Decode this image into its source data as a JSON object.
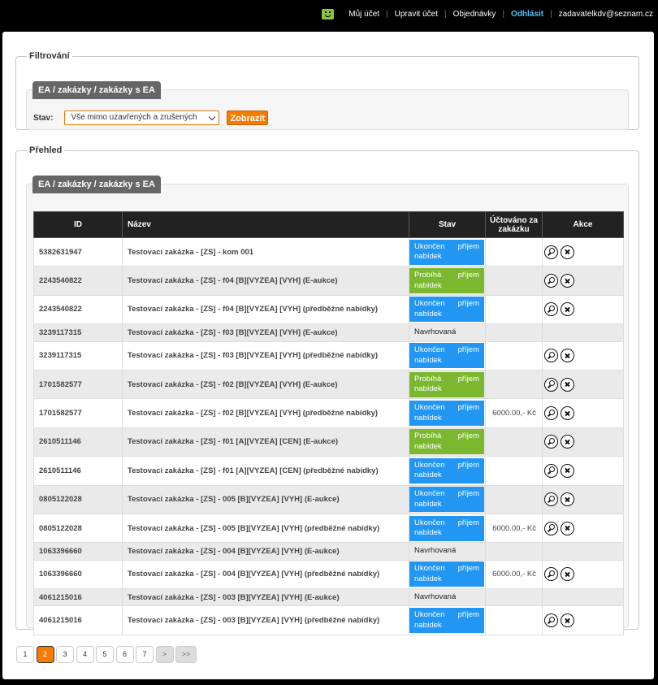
{
  "topbar": {
    "my_account": "Můj účet",
    "edit_account": "Upravit účet",
    "orders": "Objednávky",
    "logout": "Odhlásit",
    "email": "zadavatelkdv@seznam.cz"
  },
  "filter": {
    "legend": "Filtrování",
    "tab": "EA / zakázky / zakázky s EA",
    "status_label": "Stav:",
    "status_value": "Vše mimo uzavřených a zrušených",
    "submit_label": "Zobrazit"
  },
  "overview": {
    "legend": "Přehled",
    "tab": "EA / zakázky / zakázky s EA",
    "columns": {
      "id": "ID",
      "name": "Název",
      "status": "Stav",
      "billed": "Účtováno za zakázku",
      "actions": "Akce"
    },
    "rows": [
      {
        "id": "5382631947",
        "name": "Testovací zakázka - [ZS] - kom 001",
        "status": "Ukončen příjem nabídek",
        "status_type": "blue",
        "billed": "",
        "actions": true
      },
      {
        "id": "2243540822",
        "name": "Testovací zakázka - [ZS] - f04 [B][VYZEA] [VYH] (E-aukce)",
        "status": "Probíhá příjem nabídek",
        "status_type": "green",
        "billed": "",
        "actions": true
      },
      {
        "id": "2243540822",
        "name": "Testovací zakázka - [ZS] - f04 [B][VYZEA] [VYH] (předběžné nabídky)",
        "status": "Ukončen příjem nabídek",
        "status_type": "blue",
        "billed": "",
        "actions": true
      },
      {
        "id": "3239117315",
        "name": "Testovací zakázka - [ZS] - f03 [B][VYZEA] [VYH] (E-aukce)",
        "status": "Navrhovaná",
        "status_type": "plain",
        "billed": "",
        "actions": false
      },
      {
        "id": "3239117315",
        "name": "Testovací zakázka - [ZS] - f03 [B][VYZEA] [VYH] (předběžné nabídky)",
        "status": "Ukončen příjem nabídek",
        "status_type": "blue",
        "billed": "",
        "actions": true
      },
      {
        "id": "1701582577",
        "name": "Testovací zakázka - [ZS] - f02 [B][VYZEA] [VYH] (E-aukce)",
        "status": "Probíhá příjem nabídek",
        "status_type": "green",
        "billed": "",
        "actions": true
      },
      {
        "id": "1701582577",
        "name": "Testovací zakázka - [ZS] - f02 [B][VYZEA] [VYH] (předběžné nabídky)",
        "status": "Ukončen příjem nabídek",
        "status_type": "blue",
        "billed": "6000.00,- Kč",
        "actions": true
      },
      {
        "id": "2610511146",
        "name": "Testovací zakázka - [ZS] - f01 [A][VYZEA] [CEN] (E-aukce)",
        "status": "Probíhá příjem nabídek",
        "status_type": "green",
        "billed": "",
        "actions": true
      },
      {
        "id": "2610511146",
        "name": "Testovací zakázka - [ZS] - f01 [A][VYZEA] [CEN] (předběžné nabídky)",
        "status": "Ukončen příjem nabídek",
        "status_type": "blue",
        "billed": "",
        "actions": true
      },
      {
        "id": "0805122028",
        "name": "Testovací zakázka - [ZS] - 005 [B][VYZEA] [VYH] (E-aukce)",
        "status": "Ukončen příjem nabídek",
        "status_type": "blue",
        "billed": "",
        "actions": true
      },
      {
        "id": "0805122028",
        "name": "Testovací zakázka - [ZS] - 005 [B][VYZEA] [VYH] (předběžné nabídky)",
        "status": "Ukončen příjem nabídek",
        "status_type": "blue",
        "billed": "6000.00,- Kč",
        "actions": true
      },
      {
        "id": "1063396660",
        "name": "Testovací zakázka - [ZS] - 004 [B][VYZEA] [VYH] (E-aukce)",
        "status": "Navrhovaná",
        "status_type": "plain",
        "billed": "",
        "actions": false
      },
      {
        "id": "1063396660",
        "name": "Testovací zakázka - [ZS] - 004 [B][VYZEA] [VYH] (předběžné nabídky)",
        "status": "Ukončen příjem nabídek",
        "status_type": "blue",
        "billed": "6000.00,- Kč",
        "actions": true
      },
      {
        "id": "4061215016",
        "name": "Testovací zakázka - [ZS] - 003 [B][VYZEA] [VYH] (E-aukce)",
        "status": "Navrhovaná",
        "status_type": "plain",
        "billed": "",
        "actions": false
      },
      {
        "id": "4061215016",
        "name": "Testovací zakázka - [ZS] - 003 [B][VYZEA] [VYH] (předběžné nabídky)",
        "status": "Ukončen příjem nabídek",
        "status_type": "blue",
        "billed": "",
        "actions": true
      }
    ]
  },
  "pagination": {
    "pages": [
      "1",
      "2",
      "3",
      "4",
      "5",
      "6",
      "7"
    ],
    "current": "2",
    "next": ">",
    "last": ">>"
  },
  "icons": {
    "detail": "magnifier-icon",
    "cancel": "close-icon",
    "user": "smiley-icon"
  },
  "colors": {
    "accent": "#f57c00",
    "status_blue": "#2196f3",
    "status_green": "#7cb82f",
    "logout": "#4fc3f7"
  }
}
